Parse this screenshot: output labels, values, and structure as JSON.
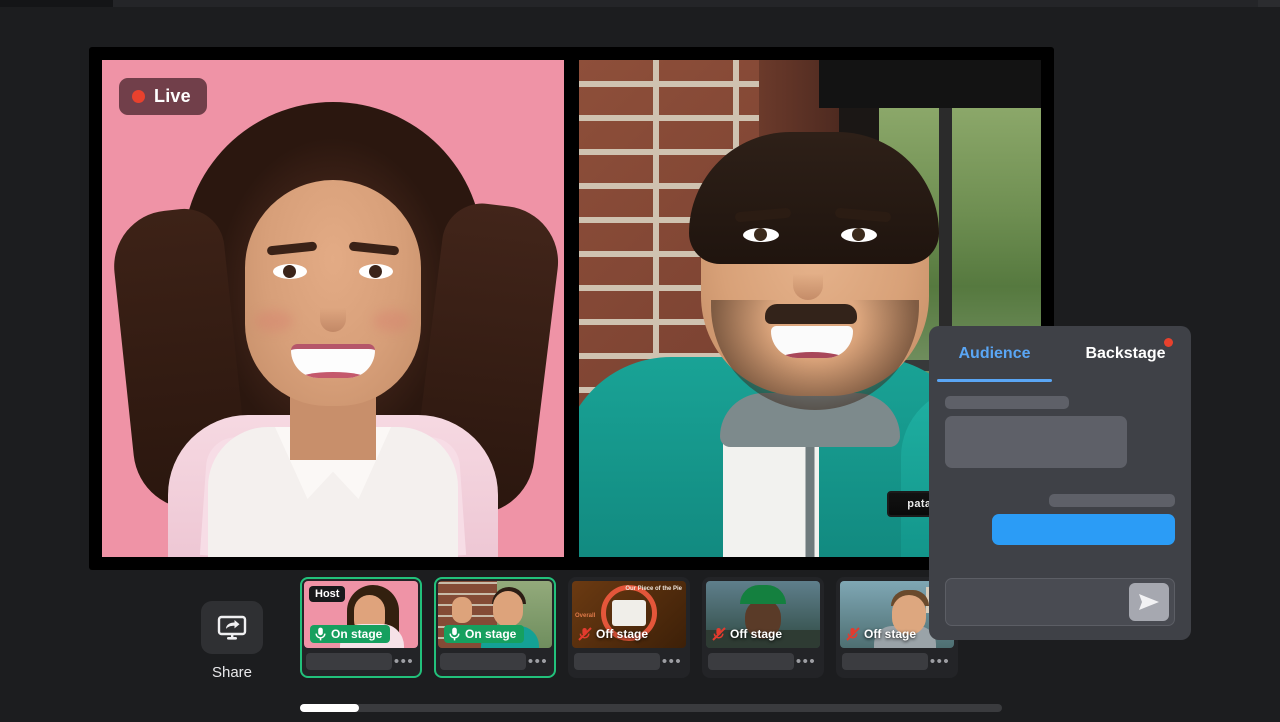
{
  "stage": {
    "live_badge": {
      "label": "Live",
      "dot_color": "#e8412d"
    },
    "tiles": [
      {
        "name": "host-video",
        "backdrop": "pink"
      },
      {
        "name": "guest-video",
        "backdrop": "brick-window",
        "jacket_patch": "patagonia"
      }
    ]
  },
  "controls": {
    "share": {
      "label": "Share",
      "icon": "screen-share-icon"
    }
  },
  "participants": [
    {
      "badge": "Host",
      "status": "On stage",
      "status_type": "on",
      "mic": "mic-on-icon",
      "menu": "•••"
    },
    {
      "badge": "",
      "status": "On stage",
      "status_type": "on",
      "mic": "mic-on-icon",
      "menu": "•••"
    },
    {
      "badge": "",
      "status": "Off stage",
      "status_type": "off",
      "mic": "mic-muted-icon",
      "menu": "•••",
      "overlay_text_1": "Our Piece of the Pie",
      "overlay_text_2": "Overall"
    },
    {
      "badge": "",
      "status": "Off stage",
      "status_type": "off",
      "mic": "mic-muted-icon",
      "menu": "•••"
    },
    {
      "badge": "",
      "status": "Off stage",
      "status_type": "off",
      "mic": "mic-muted-icon",
      "menu": "•••"
    }
  ],
  "panel": {
    "tabs": [
      {
        "label": "Audience",
        "active": true,
        "has_dot": false
      },
      {
        "label": "Backstage",
        "active": false,
        "has_dot": true
      }
    ],
    "accent_color": "#5aa6f5",
    "message_bubble_color": "#2b9cf6",
    "send_icon": "send-icon"
  },
  "scrollbar": {
    "orientation": "horizontal",
    "thumb_position": "start"
  },
  "colors": {
    "background": "#1c1d1f",
    "stage_background": "#000000",
    "on_stage_green": "#16a05f",
    "active_thumb_border": "#22c17b",
    "panel_background": "#3f4147"
  }
}
